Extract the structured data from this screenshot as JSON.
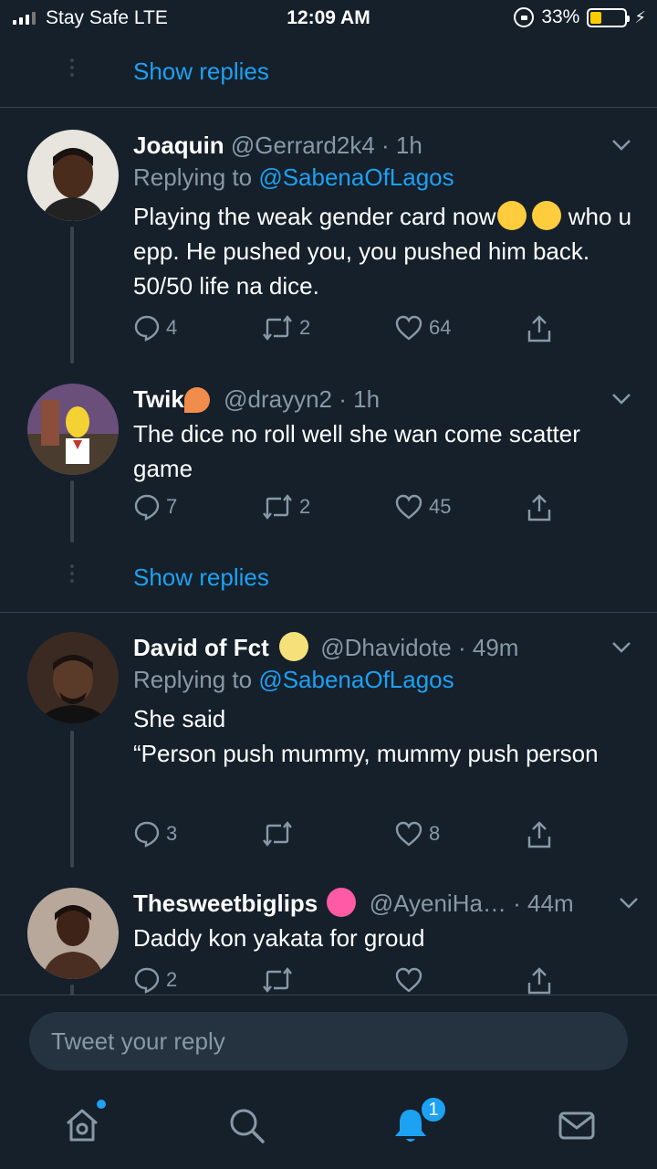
{
  "status_bar": {
    "carrier": "Stay Safe  LTE",
    "time": "12:09 AM",
    "battery": "33%",
    "battery_level": 0.33,
    "battery_color": "#ffcc00"
  },
  "show_replies_label": "Show replies",
  "tweets": [
    {
      "name": "Joaquin",
      "handle": "@Gerrard2k4",
      "time": "1h",
      "replying_prefix": "Replying to ",
      "replying_to": "@SabenaOfLagos",
      "text": "Playing the weak gender card now",
      "text2": "who u epp. He pushed you, you pushed him back. 50/50 life na dice.",
      "emojis": [
        "laughing-face-emoji",
        "rolling-laughing-emoji"
      ],
      "replies": "4",
      "retweets": "2",
      "likes": "64"
    },
    {
      "name": "Twik",
      "handle": "@drayyn2",
      "time": "1h",
      "text": "The dice no roll well she wan come scatter game",
      "emojis": [
        "ice-cream-emoji"
      ],
      "replies": "7",
      "retweets": "2",
      "likes": "45"
    },
    {
      "name": "David of Fct",
      "handle": "@Dhavidote",
      "time": "49m",
      "replying_prefix": "Replying to ",
      "replying_to": "@SabenaOfLagos",
      "text": "She said",
      "text2": "“Person push mummy, mummy push person",
      "emojis": [
        "moon-face-emoji"
      ],
      "replies": "3",
      "retweets": "",
      "likes": "8"
    },
    {
      "name": "Thesweetbiglips",
      "handle": "@AyeniHa…",
      "time": "44m",
      "text": "Daddy kon yakata for groud",
      "emojis": [
        "sparkling-heart-emoji"
      ],
      "replies": "2",
      "retweets": "",
      "likes": ""
    }
  ],
  "compose": {
    "placeholder": "Tweet your reply"
  },
  "tab_bar": {
    "items": [
      "home-icon",
      "search-icon",
      "notifications-icon",
      "messages-icon"
    ],
    "notification_count": "1"
  },
  "colors": {
    "background": "#15202b",
    "accent": "#1da1f2",
    "secondary_text": "#8899a6",
    "divider": "#38444d"
  }
}
